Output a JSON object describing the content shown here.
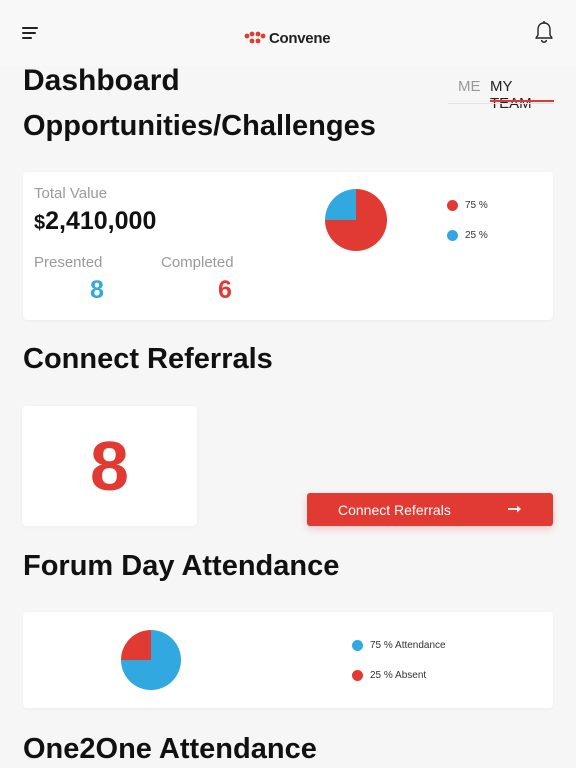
{
  "header": {
    "logo_text": "Convene",
    "menu_icon": "hamburger-menu-icon",
    "bell_icon": "notification-bell-icon"
  },
  "page": {
    "title": "Dashboard",
    "tabs": [
      {
        "label": "ME",
        "active": false
      },
      {
        "label": "MY TEAM",
        "active": true
      }
    ]
  },
  "opportunities": {
    "title": "Opportunities/Challenges",
    "total_label": "Total Value",
    "currency": "$",
    "total_value": "2,410,000",
    "presented_label": "Presented",
    "presented_value": "8",
    "completed_label": "Completed",
    "completed_value": "6",
    "legend": [
      {
        "label": "75 %",
        "color": "#e03a33"
      },
      {
        "label": "25 %",
        "color": "#32a8e0"
      }
    ],
    "pie": [
      {
        "value": 75,
        "color": "#e03a33"
      },
      {
        "value": 25,
        "color": "#32a8e0"
      }
    ]
  },
  "referrals": {
    "title": "Connect Referrals",
    "count": "8",
    "button_label": "Connect Referrals"
  },
  "forum": {
    "title": "Forum Day Attendance",
    "legend": [
      {
        "label": "75 % Attendance",
        "color": "#32a8e0"
      },
      {
        "label": "25 % Absent",
        "color": "#e03a33"
      }
    ],
    "pie": [
      {
        "value": 75,
        "color": "#32a8e0"
      },
      {
        "value": 25,
        "color": "#e03a33"
      }
    ]
  },
  "one2one": {
    "title": "One2One Attendance"
  },
  "colors": {
    "accent_red": "#e03a33",
    "accent_blue": "#32a8e0"
  }
}
